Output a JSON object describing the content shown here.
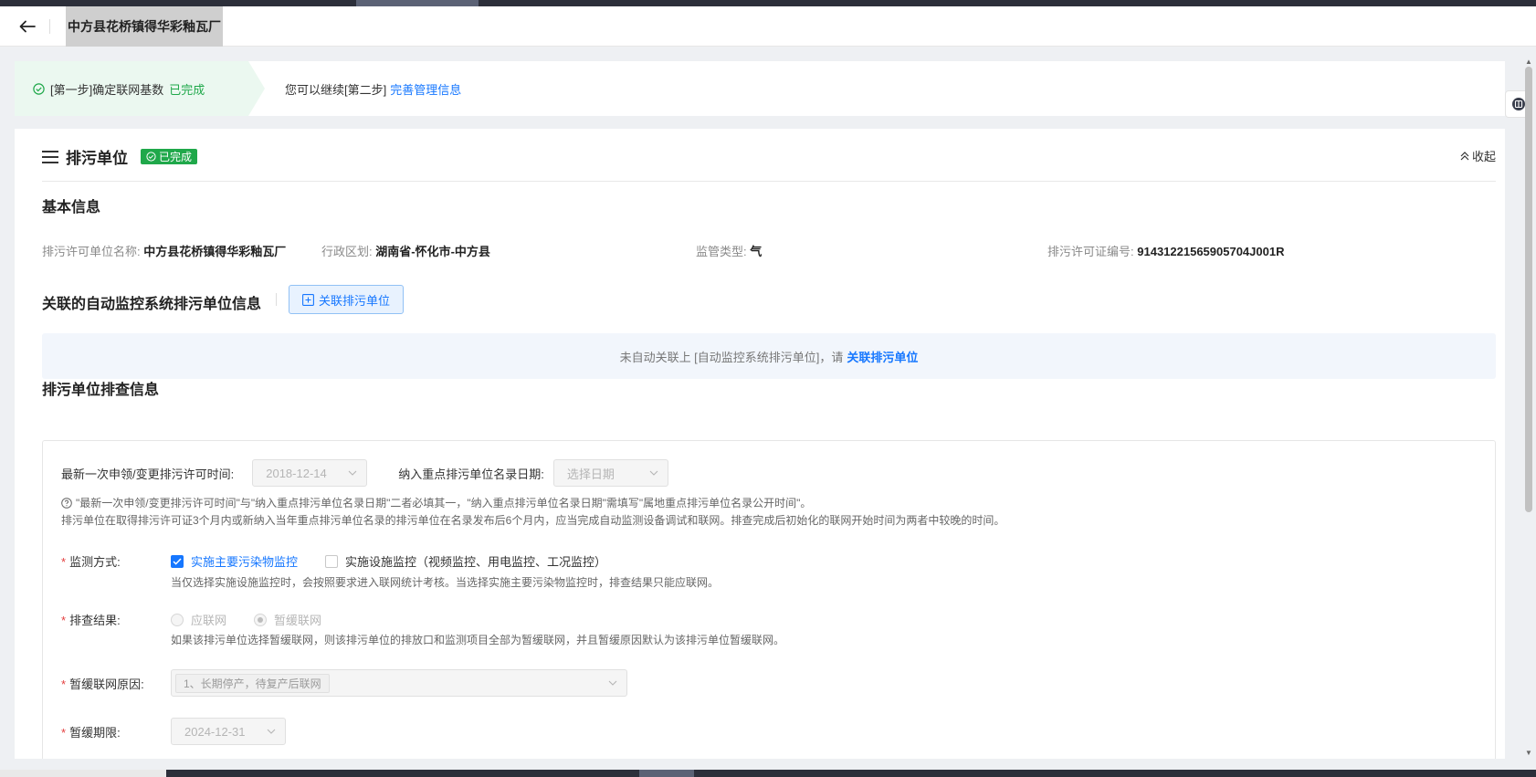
{
  "header": {
    "back_icon": "arrow-left-icon",
    "title": "中方县花桥镇得华彩釉瓦厂"
  },
  "steps": {
    "step1_text": "[第一步]确定联网基数",
    "step1_status": "已完成",
    "step2_text": "您可以继续[第二步]",
    "step2_link": "完善管理信息"
  },
  "section": {
    "title": "排污单位",
    "badge": "已完成",
    "collapse_label": "收起"
  },
  "basic": {
    "title": "基本信息",
    "name_label": "排污许可单位名称:",
    "name_value": "中方县花桥镇得华彩釉瓦厂",
    "region_label": "行政区划:",
    "region_value": "湖南省-怀化市-中方县",
    "type_label": "监管类型:",
    "type_value": "气",
    "license_label": "排污许可证编号:",
    "license_value": "91431221565905704J001R"
  },
  "linked": {
    "title": "关联的自动监控系统排污单位信息",
    "button_label": "关联排污单位",
    "notice_text": "未自动关联上 [自动监控系统排污单位]，请",
    "notice_link": "关联排污单位"
  },
  "inspection": {
    "title": "排污单位排查信息",
    "latest_label": "最新一次申领/变更排污许可时间:",
    "latest_value": "2018-12-14",
    "key_date_label": "纳入重点排污单位名录日期:",
    "key_date_placeholder": "选择日期",
    "hint1": "\"最新一次申领/变更排污许可时间\"与\"纳入重点排污单位名录日期\"二者必填其一，\"纳入重点排污单位名录日期\"需填写\"属地重点排污单位名录公开时间\"。",
    "hint2": "排污单位在取得排污许可证3个月内或新纳入当年重点排污单位名录的排污单位在名录发布后6个月内，应当完成自动监测设备调试和联网。排查完成后初始化的联网开始时间为两者中较晚的时间。",
    "monitor_label": "监测方式:",
    "monitor_opt1": "实施主要污染物监控",
    "monitor_opt2": "实施设施监控（视频监控、用电监控、工况监控）",
    "monitor_hint": "当仅选择实施设施监控时，会按照要求进入联网统计考核。当选择实施主要污染物监控时，排查结果只能应联网。",
    "result_label": "排查结果:",
    "result_opt1": "应联网",
    "result_opt2": "暂缓联网",
    "result_hint": "如果该排污单位选择暂缓联网，则该排污单位的排放口和监测项目全部为暂缓联网，并且暂缓原因默认为该排污单位暂缓联网。",
    "reason_label": "暂缓联网原因:",
    "reason_tag": "1、长期停产，待复产后联网",
    "deadline_label": "暂缓期限:",
    "deadline_value": "2024-12-31"
  },
  "colors": {
    "accent": "#1677ff",
    "success": "#1fa84a",
    "required": "#e43e3e"
  }
}
